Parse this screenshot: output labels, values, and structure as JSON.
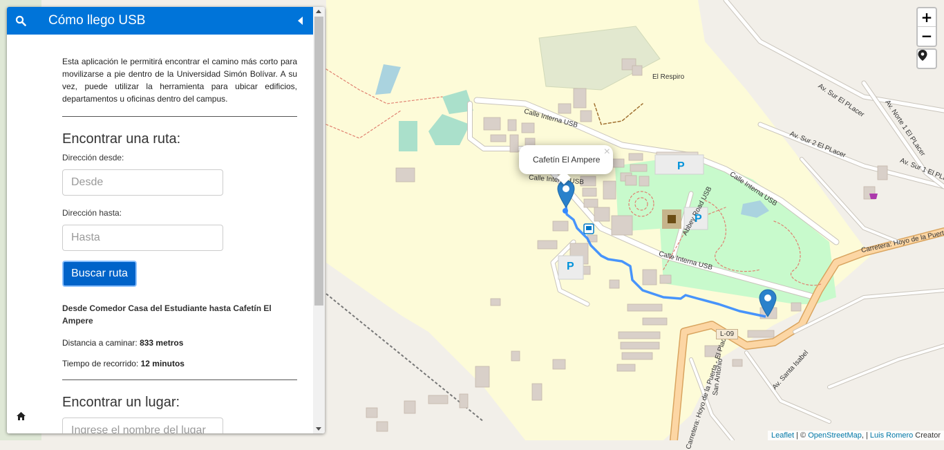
{
  "app": {
    "title": "Cómo llego USB",
    "intro": "Esta aplicación le permitirá encontrar el camino más corto para movilizarse a pie dentro de la Universidad Simón Bolívar. A su vez, puede utilizar la herramienta para ubicar edificios, departamentos u oficinas dentro del campus."
  },
  "route_form": {
    "heading": "Encontrar una ruta:",
    "from_label": "Dirección desde:",
    "from_placeholder": "Desde",
    "from_value": "",
    "to_label": "Dirección hasta:",
    "to_placeholder": "Hasta",
    "to_value": "",
    "search_button": "Buscar ruta"
  },
  "route_result": {
    "title": "Desde Comedor Casa del Estudiante hasta Cafetín El Ampere",
    "distance_label": "Distancia a caminar:",
    "distance_value": "833 metros",
    "time_label": "Tiempo de recorrido:",
    "time_value": "12 minutos"
  },
  "place_form": {
    "heading": "Encontrar un lugar:",
    "placeholder": "Ingrese el nombre del lugar"
  },
  "map": {
    "popup_text": "Cafetín El Ampere",
    "close_glyph": "×",
    "zoom_in": "+",
    "zoom_out": "−",
    "labels": {
      "el_respiro": "El Respiro",
      "calle_interna_1": "Calle Interna USB",
      "calle_interna_2": "Calle Interna USB",
      "calle_interna_3": "Calle Interna USB",
      "calle_interna_4": "Calle Interna USB",
      "abbey_road": "Abbey Road USB",
      "carretera_hoyo_1": "Carretera: Hoyo de la Puerta",
      "carretera_hoyo_2": "Carretera: Hoyo de la Puerta - El Placer",
      "l09": "L-09",
      "av_sur_el_placer": "Av. Sur El PLacer",
      "av_norte_1": "Av. Norte 1 El PLacer",
      "av_sur_2": "Av. Sur 2 El PLacer",
      "av_sur_1": "Av. Sur 1 El PLa",
      "san_antonio": "San Antonio",
      "av_santa_isabel": "Av. Santa Isabel",
      "parking": "P"
    },
    "attribution": {
      "leaflet": "Leaflet",
      "sep1": " | © ",
      "osm": "OpenStreetMap",
      "sep2": ", | ",
      "author": "Luis Romero",
      "suffix": " Creator"
    },
    "colors": {
      "route": "#3388ff",
      "marker": "#2a81cb",
      "campus": "#fdfbd8",
      "park": "#c8facc",
      "accent": "#0074d9"
    }
  }
}
